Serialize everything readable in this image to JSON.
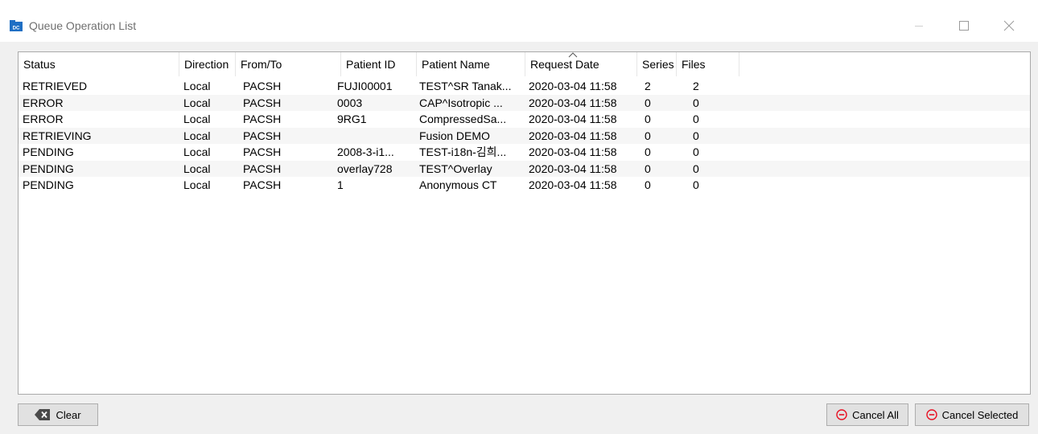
{
  "window": {
    "title": "Queue Operation List",
    "app_icon_text": "DC"
  },
  "table": {
    "columns": [
      "Status",
      "Direction",
      "From/To",
      "Patient ID",
      "Patient Name",
      "Request Date",
      "Series",
      "Files"
    ],
    "rows": [
      [
        "RETRIEVED",
        "Local",
        "PACSH",
        "FUJI00001",
        "TEST^SR Tanak...",
        "2020-03-04  11:58",
        "2",
        "2"
      ],
      [
        "ERROR",
        "Local",
        "PACSH",
        "0003",
        "CAP^Isotropic ...",
        "2020-03-04  11:58",
        "0",
        "0"
      ],
      [
        "ERROR",
        "Local",
        "PACSH",
        "9RG1",
        "CompressedSa...",
        "2020-03-04  11:58",
        "0",
        "0"
      ],
      [
        "RETRIEVING",
        "Local",
        "PACSH",
        "",
        "Fusion DEMO",
        "2020-03-04  11:58",
        "0",
        "0"
      ],
      [
        "PENDING",
        "Local",
        "PACSH",
        "2008-3-i1...",
        "TEST-i18n-김희...",
        "2020-03-04  11:58",
        "0",
        "0"
      ],
      [
        "PENDING",
        "Local",
        "PACSH",
        "overlay728",
        "TEST^Overlay",
        "2020-03-04  11:58",
        "0",
        "0"
      ],
      [
        "PENDING",
        "Local",
        "PACSH",
        "1",
        "Anonymous CT",
        "2020-03-04  11:58",
        "0",
        "0"
      ]
    ],
    "sort_column": "Request Date",
    "sort_direction": "ascending"
  },
  "footer": {
    "clear_label": "Clear",
    "cancel_all_label": "Cancel All",
    "cancel_selected_label": "Cancel Selected"
  },
  "colors": {
    "accent_icon": "#1f6fc4",
    "cancel_icon": "#e81123"
  },
  "icons": {
    "clear": "backspace-icon",
    "cancel": "minus-circle-icon",
    "sort": "sort-ascending-icon"
  }
}
